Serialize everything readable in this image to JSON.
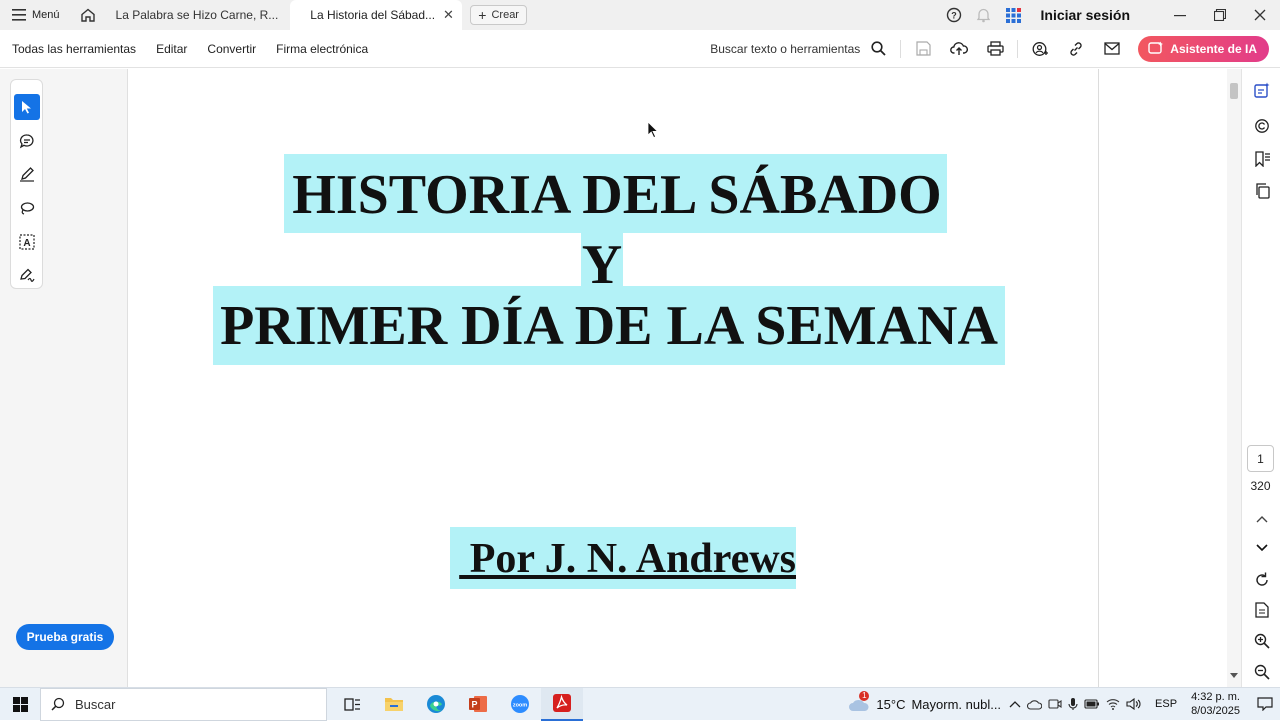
{
  "tabbar": {
    "menu_label": "Menú",
    "tabs": [
      {
        "label": "La Palabra se Hizo Carne, R..."
      },
      {
        "label": "La Historia del Sábad..."
      }
    ],
    "create_label": "Crear",
    "signin_label": "Iniciar sesión"
  },
  "toolbar": {
    "items": [
      "Todas las herramientas",
      "Editar",
      "Convertir",
      "Firma electrónica"
    ],
    "search_label": "Buscar texto o herramientas",
    "ai_label": "Asistente de IA"
  },
  "document": {
    "line1": "HISTORIA DEL SÁBADO",
    "line2": "Y",
    "line3": "PRIMER DÍA DE LA SEMANA",
    "author": " Por J. N. Andrews",
    "highlight_color": "#b3f2f7"
  },
  "sidebar": {
    "trial_label": "Prueba gratis",
    "accent": "#1473e6"
  },
  "pagination": {
    "current": "1",
    "total": "320"
  },
  "taskbar": {
    "search_placeholder": "Buscar",
    "weather_temp": "15°C",
    "weather_desc": "Mayorm. nubl...",
    "weather_alert": "1",
    "language": "ESP",
    "time": "4:32 p. m.",
    "date": "8/03/2025"
  }
}
